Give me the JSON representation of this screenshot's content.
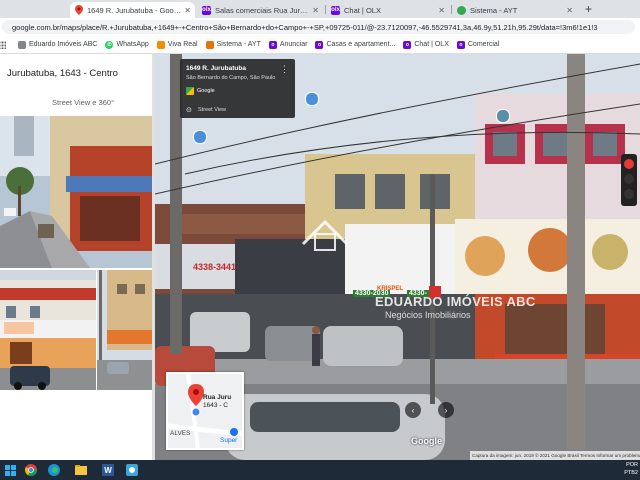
{
  "browser": {
    "tabs": [
      {
        "title": "1649 R. Jurubatuba - Google Maps",
        "icon": "google-maps-pin-icon",
        "color": "#ea4335",
        "active": true
      },
      {
        "title": "Salas comerciais Rua Jurubatuba",
        "icon": "olx-icon",
        "color": "#6e0ad6",
        "active": false
      },
      {
        "title": "Chat | OLX",
        "icon": "olx-icon",
        "color": "#6e0ad6",
        "active": false
      },
      {
        "title": "Sistema - AYT",
        "icon": "green-circle-icon",
        "color": "#34a853",
        "active": false
      }
    ],
    "new_tab_label": "+",
    "url": "google.com.br/maps/place/R.+Jurubatuba,+1649+-+Centro+São+Bernardo+do+Campo+-+SP,+09725-011/@-23.7120097,-46.5529741,3a,46.9y,51.21h,95.29t/data=!3m6!1e1!3",
    "bookmarks": [
      {
        "label": "Eduardo Imóveis ABC",
        "icon": "page-icon",
        "color": "#80868b"
      },
      {
        "label": "WhatsApp",
        "icon": "whatsapp-icon",
        "color": "#25d366"
      },
      {
        "label": "Viva Real",
        "icon": "vivareal-icon",
        "color": "#f28c00"
      },
      {
        "label": "Sistema - AYT",
        "icon": "ayt-icon",
        "color": "#e8710a"
      },
      {
        "label": "Anunciar",
        "icon": "olx-icon",
        "color": "#6e0ad6"
      },
      {
        "label": "Casas e apartament...",
        "icon": "olx-icon",
        "color": "#6e0ad6"
      },
      {
        "label": "Chat | OLX",
        "icon": "olx-icon",
        "color": "#6e0ad6"
      },
      {
        "label": "Comercial",
        "icon": "olx-icon",
        "color": "#6e0ad6"
      }
    ]
  },
  "panel": {
    "title": "Jurubatuba, 1643 - Centro",
    "street_view_link": "Street View e 360°"
  },
  "street_view": {
    "card_address": "1649 R. Jurubatuba",
    "card_city": "São Bernardo do Campo, São Paulo",
    "card_source": "Google",
    "card_link": "Street View",
    "watermark_title": "EDUARDO IMÓVEIS ABC",
    "watermark_subtitle": "Negócios Imobiliários",
    "sign_phone_1": "4338-3441",
    "sign_phone_2": "4330-2030",
    "sign_phone_3": "4330-",
    "sign_brand": "KRISPEL",
    "google_logo": "Google",
    "credits": "Captura da imagem: jun. 2019   © 2021 Google   Brasil   Termos   Informar um problema",
    "minimap": {
      "place_line1": "Rua Juru",
      "place_line2": "1643 - C",
      "street_label": "ALVES",
      "store_label": "Super"
    }
  },
  "taskbar": {
    "apps": [
      "windows-start-icon",
      "chrome-icon",
      "edge-icon",
      "file-explorer-icon",
      "word-icon",
      "app-icon"
    ],
    "tray_line1": "POR",
    "tray_line2": "PTB2"
  }
}
